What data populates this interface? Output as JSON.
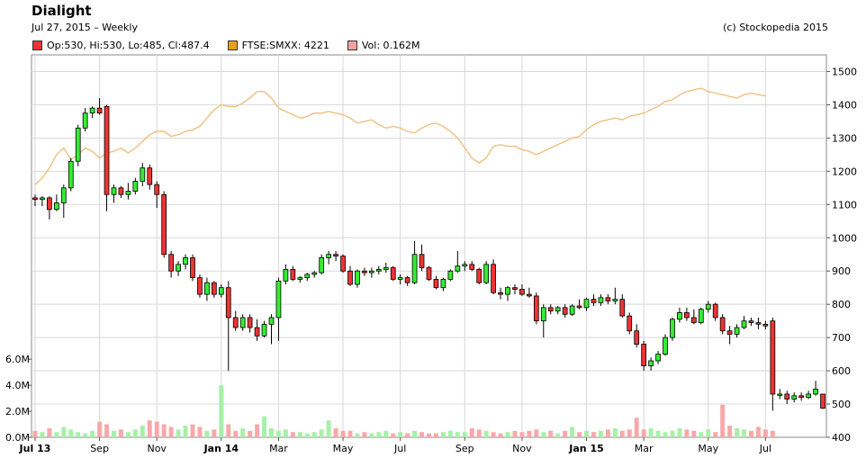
{
  "header": {
    "title": "Dialight",
    "subtitle": "Jul 27, 2015 – Weekly",
    "credit": "(c) Stockopedia 2015"
  },
  "legend": {
    "price": "Op:530, Hi:530, Lo:485, Cl:487.4",
    "index": "FTSE:SMXX: 4221",
    "volume": "Vol: 0.162M"
  },
  "colors": {
    "up": "#33ee33",
    "down": "#ee3333",
    "index_line": "#f0c080",
    "volume_up": "#a8f0a8",
    "volume_down": "#f8a8a8",
    "index_swatch": "#e8a020",
    "volume_swatch": "#f8a0a0",
    "grid": "#d8d8d8"
  },
  "chart_data": {
    "type": "candlestick",
    "title": "Dialight",
    "frequency": "Weekly",
    "price_axis": {
      "ticks": [
        400,
        500,
        600,
        700,
        800,
        900,
        1000,
        1100,
        1200,
        1300,
        1400,
        1500
      ],
      "range": [
        400,
        1550
      ],
      "side": "right"
    },
    "volume_axis": {
      "ticks": [
        "0.0M",
        "2.0M",
        "4.0M",
        "6.0M"
      ],
      "tick_values": [
        0,
        2,
        4,
        6
      ],
      "range": [
        0,
        6.5
      ],
      "side": "left"
    },
    "x_tick_labels": [
      "Jul 13",
      "Sep",
      "Nov",
      "Jan 14",
      "Mar",
      "May",
      "Jul",
      "Sep",
      "Nov",
      "Jan 15",
      "Mar",
      "May",
      "Jul"
    ],
    "x_tick_weeks": [
      0,
      9,
      17,
      26,
      34,
      43,
      51,
      60,
      68,
      77,
      85,
      94,
      102
    ],
    "bold_ticks": [
      "Jul 13",
      "Jan 14",
      "Jan 15"
    ],
    "grid": true,
    "candles": [
      {
        "o": 1120,
        "h": 1130,
        "l": 1095,
        "c": 1115
      },
      {
        "o": 1115,
        "h": 1125,
        "l": 1095,
        "c": 1120
      },
      {
        "o": 1120,
        "h": 1125,
        "l": 1055,
        "c": 1085
      },
      {
        "o": 1085,
        "h": 1130,
        "l": 1080,
        "c": 1105
      },
      {
        "o": 1105,
        "h": 1160,
        "l": 1060,
        "c": 1150
      },
      {
        "o": 1150,
        "h": 1240,
        "l": 1140,
        "c": 1230
      },
      {
        "o": 1230,
        "h": 1340,
        "l": 1215,
        "c": 1330
      },
      {
        "o": 1330,
        "h": 1390,
        "l": 1320,
        "c": 1375
      },
      {
        "o": 1375,
        "h": 1395,
        "l": 1360,
        "c": 1390
      },
      {
        "o": 1390,
        "h": 1420,
        "l": 1370,
        "c": 1375
      },
      {
        "o": 1395,
        "h": 1400,
        "l": 1080,
        "c": 1130
      },
      {
        "o": 1130,
        "h": 1160,
        "l": 1105,
        "c": 1150
      },
      {
        "o": 1150,
        "h": 1155,
        "l": 1120,
        "c": 1130
      },
      {
        "o": 1130,
        "h": 1165,
        "l": 1115,
        "c": 1140
      },
      {
        "o": 1140,
        "h": 1180,
        "l": 1130,
        "c": 1170
      },
      {
        "o": 1170,
        "h": 1225,
        "l": 1155,
        "c": 1210
      },
      {
        "o": 1210,
        "h": 1220,
        "l": 1145,
        "c": 1160
      },
      {
        "o": 1160,
        "h": 1170,
        "l": 1090,
        "c": 1130
      },
      {
        "o": 1130,
        "h": 1140,
        "l": 940,
        "c": 950
      },
      {
        "o": 950,
        "h": 960,
        "l": 880,
        "c": 900
      },
      {
        "o": 900,
        "h": 930,
        "l": 885,
        "c": 920
      },
      {
        "o": 920,
        "h": 950,
        "l": 905,
        "c": 940
      },
      {
        "o": 940,
        "h": 950,
        "l": 870,
        "c": 880
      },
      {
        "o": 880,
        "h": 890,
        "l": 820,
        "c": 830
      },
      {
        "o": 830,
        "h": 880,
        "l": 810,
        "c": 865
      },
      {
        "o": 865,
        "h": 870,
        "l": 820,
        "c": 830
      },
      {
        "o": 830,
        "h": 860,
        "l": 820,
        "c": 850
      },
      {
        "o": 850,
        "h": 870,
        "l": 600,
        "c": 760
      },
      {
        "o": 760,
        "h": 780,
        "l": 720,
        "c": 730
      },
      {
        "o": 730,
        "h": 770,
        "l": 720,
        "c": 760
      },
      {
        "o": 760,
        "h": 770,
        "l": 715,
        "c": 730
      },
      {
        "o": 730,
        "h": 755,
        "l": 690,
        "c": 705
      },
      {
        "o": 705,
        "h": 750,
        "l": 700,
        "c": 740
      },
      {
        "o": 740,
        "h": 770,
        "l": 680,
        "c": 760
      },
      {
        "o": 760,
        "h": 880,
        "l": 690,
        "c": 870
      },
      {
        "o": 870,
        "h": 920,
        "l": 860,
        "c": 905
      },
      {
        "o": 905,
        "h": 915,
        "l": 870,
        "c": 875
      },
      {
        "o": 875,
        "h": 885,
        "l": 865,
        "c": 880
      },
      {
        "o": 880,
        "h": 895,
        "l": 870,
        "c": 890
      },
      {
        "o": 890,
        "h": 900,
        "l": 880,
        "c": 895
      },
      {
        "o": 895,
        "h": 950,
        "l": 890,
        "c": 940
      },
      {
        "o": 940,
        "h": 960,
        "l": 920,
        "c": 950
      },
      {
        "o": 950,
        "h": 960,
        "l": 930,
        "c": 945
      },
      {
        "o": 945,
        "h": 950,
        "l": 895,
        "c": 900
      },
      {
        "o": 900,
        "h": 915,
        "l": 855,
        "c": 860
      },
      {
        "o": 860,
        "h": 905,
        "l": 850,
        "c": 900
      },
      {
        "o": 900,
        "h": 910,
        "l": 885,
        "c": 895
      },
      {
        "o": 895,
        "h": 910,
        "l": 880,
        "c": 900
      },
      {
        "o": 900,
        "h": 915,
        "l": 890,
        "c": 905
      },
      {
        "o": 905,
        "h": 925,
        "l": 895,
        "c": 910
      },
      {
        "o": 910,
        "h": 915,
        "l": 870,
        "c": 875
      },
      {
        "o": 875,
        "h": 890,
        "l": 860,
        "c": 880
      },
      {
        "o": 880,
        "h": 885,
        "l": 855,
        "c": 865
      },
      {
        "o": 865,
        "h": 990,
        "l": 860,
        "c": 950
      },
      {
        "o": 950,
        "h": 980,
        "l": 900,
        "c": 910
      },
      {
        "o": 910,
        "h": 915,
        "l": 870,
        "c": 875
      },
      {
        "o": 875,
        "h": 885,
        "l": 845,
        "c": 850
      },
      {
        "o": 850,
        "h": 880,
        "l": 840,
        "c": 875
      },
      {
        "o": 875,
        "h": 905,
        "l": 870,
        "c": 900
      },
      {
        "o": 900,
        "h": 960,
        "l": 895,
        "c": 915
      },
      {
        "o": 915,
        "h": 930,
        "l": 900,
        "c": 920
      },
      {
        "o": 920,
        "h": 930,
        "l": 900,
        "c": 905
      },
      {
        "o": 905,
        "h": 910,
        "l": 860,
        "c": 865
      },
      {
        "o": 865,
        "h": 930,
        "l": 860,
        "c": 920
      },
      {
        "o": 920,
        "h": 935,
        "l": 830,
        "c": 835
      },
      {
        "o": 835,
        "h": 850,
        "l": 815,
        "c": 830
      },
      {
        "o": 830,
        "h": 855,
        "l": 810,
        "c": 850
      },
      {
        "o": 850,
        "h": 860,
        "l": 830,
        "c": 845
      },
      {
        "o": 845,
        "h": 860,
        "l": 825,
        "c": 830
      },
      {
        "o": 830,
        "h": 850,
        "l": 820,
        "c": 825
      },
      {
        "o": 825,
        "h": 835,
        "l": 740,
        "c": 750
      },
      {
        "o": 750,
        "h": 800,
        "l": 700,
        "c": 790
      },
      {
        "o": 790,
        "h": 800,
        "l": 770,
        "c": 780
      },
      {
        "o": 780,
        "h": 795,
        "l": 770,
        "c": 790
      },
      {
        "o": 790,
        "h": 800,
        "l": 760,
        "c": 770
      },
      {
        "o": 770,
        "h": 800,
        "l": 765,
        "c": 795
      },
      {
        "o": 795,
        "h": 815,
        "l": 785,
        "c": 790
      },
      {
        "o": 790,
        "h": 820,
        "l": 780,
        "c": 815
      },
      {
        "o": 815,
        "h": 830,
        "l": 795,
        "c": 805
      },
      {
        "o": 805,
        "h": 830,
        "l": 795,
        "c": 820
      },
      {
        "o": 820,
        "h": 830,
        "l": 800,
        "c": 810
      },
      {
        "o": 810,
        "h": 850,
        "l": 800,
        "c": 815
      },
      {
        "o": 815,
        "h": 830,
        "l": 760,
        "c": 765
      },
      {
        "o": 765,
        "h": 775,
        "l": 710,
        "c": 720
      },
      {
        "o": 720,
        "h": 740,
        "l": 670,
        "c": 680
      },
      {
        "o": 680,
        "h": 690,
        "l": 600,
        "c": 615
      },
      {
        "o": 615,
        "h": 640,
        "l": 600,
        "c": 630
      },
      {
        "o": 630,
        "h": 660,
        "l": 620,
        "c": 650
      },
      {
        "o": 650,
        "h": 710,
        "l": 645,
        "c": 700
      },
      {
        "o": 700,
        "h": 760,
        "l": 690,
        "c": 755
      },
      {
        "o": 755,
        "h": 790,
        "l": 745,
        "c": 775
      },
      {
        "o": 775,
        "h": 790,
        "l": 750,
        "c": 760
      },
      {
        "o": 760,
        "h": 785,
        "l": 740,
        "c": 745
      },
      {
        "o": 745,
        "h": 790,
        "l": 740,
        "c": 785
      },
      {
        "o": 785,
        "h": 810,
        "l": 775,
        "c": 800
      },
      {
        "o": 800,
        "h": 805,
        "l": 750,
        "c": 760
      },
      {
        "o": 760,
        "h": 770,
        "l": 710,
        "c": 720
      },
      {
        "o": 720,
        "h": 735,
        "l": 680,
        "c": 710
      },
      {
        "o": 710,
        "h": 740,
        "l": 700,
        "c": 730
      },
      {
        "o": 730,
        "h": 765,
        "l": 725,
        "c": 750
      },
      {
        "o": 750,
        "h": 760,
        "l": 735,
        "c": 745
      },
      {
        "o": 745,
        "h": 760,
        "l": 725,
        "c": 740
      },
      {
        "o": 740,
        "h": 750,
        "l": 725,
        "c": 735
      },
      {
        "o": 750,
        "h": 760,
        "l": 480,
        "c": 530
      },
      {
        "o": 530,
        "h": 545,
        "l": 515,
        "c": 530
      },
      {
        "o": 530,
        "h": 540,
        "l": 500,
        "c": 515
      },
      {
        "o": 515,
        "h": 535,
        "l": 505,
        "c": 525
      },
      {
        "o": 525,
        "h": 535,
        "l": 510,
        "c": 520
      },
      {
        "o": 520,
        "h": 540,
        "l": 515,
        "c": 530
      },
      {
        "o": 530,
        "h": 570,
        "l": 525,
        "c": 545
      },
      {
        "o": 530,
        "h": 530,
        "l": 485,
        "c": 487.4
      }
    ],
    "index_series": [
      1160,
      1180,
      1210,
      1250,
      1270,
      1235,
      1250,
      1270,
      1260,
      1240,
      1255,
      1260,
      1270,
      1255,
      1270,
      1290,
      1310,
      1320,
      1320,
      1305,
      1310,
      1320,
      1325,
      1335,
      1360,
      1385,
      1400,
      1395,
      1395,
      1405,
      1420,
      1440,
      1440,
      1420,
      1390,
      1380,
      1370,
      1360,
      1365,
      1375,
      1375,
      1380,
      1375,
      1370,
      1360,
      1345,
      1350,
      1355,
      1340,
      1330,
      1335,
      1330,
      1320,
      1315,
      1330,
      1340,
      1345,
      1335,
      1320,
      1300,
      1270,
      1240,
      1225,
      1240,
      1275,
      1280,
      1275,
      1275,
      1265,
      1260,
      1250,
      1260,
      1270,
      1280,
      1290,
      1300,
      1305,
      1325,
      1340,
      1350,
      1355,
      1360,
      1355,
      1365,
      1370,
      1375,
      1385,
      1395,
      1410,
      1415,
      1430,
      1440,
      1445,
      1450,
      1440,
      1435,
      1430,
      1425,
      1420,
      1430,
      1435,
      1430,
      1427
    ],
    "index_x_offset": 0,
    "volume_M": [
      0.5,
      0.4,
      0.7,
      0.4,
      0.8,
      0.6,
      0.4,
      0.3,
      0.5,
      1.2,
      1.0,
      0.5,
      0.6,
      0.4,
      0.6,
      0.9,
      1.3,
      1.2,
      1.0,
      0.8,
      0.6,
      0.9,
      1.0,
      0.8,
      0.5,
      0.6,
      4.0,
      1.0,
      0.5,
      0.7,
      0.5,
      1.0,
      1.6,
      0.7,
      0.5,
      0.6,
      0.4,
      0.4,
      0.3,
      0.4,
      0.6,
      1.3,
      0.7,
      0.5,
      0.5,
      0.3,
      0.4,
      0.3,
      0.4,
      0.5,
      0.3,
      0.4,
      0.3,
      0.5,
      0.4,
      0.3,
      0.3,
      0.4,
      0.5,
      0.4,
      0.4,
      0.7,
      0.6,
      0.5,
      0.4,
      0.3,
      0.4,
      0.5,
      0.4,
      0.5,
      0.6,
      0.4,
      0.5,
      0.3,
      0.5,
      0.8,
      0.4,
      0.5,
      0.4,
      0.5,
      0.6,
      0.7,
      0.5,
      0.6,
      1.5,
      0.6,
      0.7,
      0.5,
      0.4,
      0.5,
      0.7,
      0.6,
      0.5,
      0.4,
      0.6,
      0.4,
      2.5,
      0.9,
      0.7,
      0.6,
      0.5,
      0.8,
      0.6,
      0.5
    ]
  }
}
